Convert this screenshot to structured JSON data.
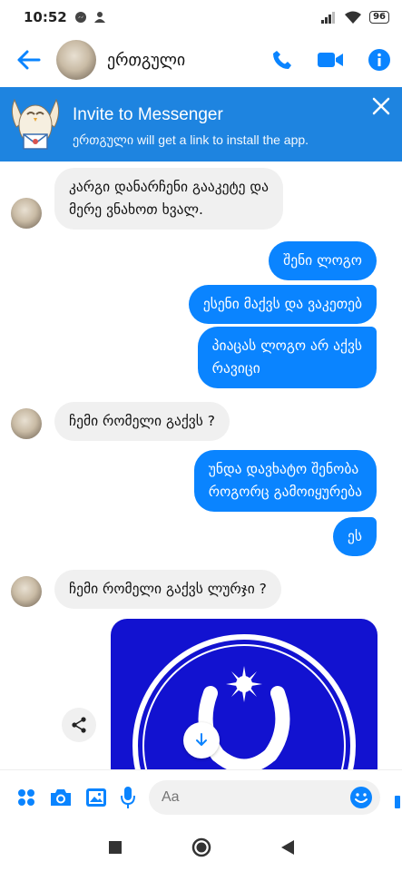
{
  "status_bar": {
    "time": "10:52",
    "battery": "96"
  },
  "header": {
    "contact_name": "ერთგული"
  },
  "banner": {
    "title": "Invite to Messenger",
    "subtitle": "ერთგული will get a link to install the app."
  },
  "messages": [
    {
      "direction": "in",
      "lines": [
        "კარგი დანარჩენი გააკეტე და",
        "მერე ვნახოთ ხვალ."
      ]
    },
    {
      "direction": "out",
      "lines": [
        "შენი ლოგო"
      ]
    },
    {
      "direction": "out",
      "lines": [
        "ესენი მაქვს და ვაკეთებ"
      ]
    },
    {
      "direction": "out",
      "lines": [
        "პიაცას ლოგო არ აქვს",
        "რავიცი"
      ]
    },
    {
      "direction": "in",
      "lines": [
        "ჩემი რომელი გაქვს ?"
      ]
    },
    {
      "direction": "out",
      "lines": [
        "უნდა დავხატო შენობა",
        "როგორც გამოიყურება"
      ]
    },
    {
      "direction": "out",
      "lines": [
        "ეს"
      ]
    },
    {
      "direction": "in",
      "lines": [
        "ჩემი რომელი გაქვს ლურჯი ?"
      ]
    }
  ],
  "composer": {
    "placeholder": "Aa"
  },
  "colors": {
    "accent": "#0a84ff",
    "banner": "#1e84e0",
    "incoming_bubble": "#f0f0f0",
    "image_blue": "#1212d0"
  }
}
